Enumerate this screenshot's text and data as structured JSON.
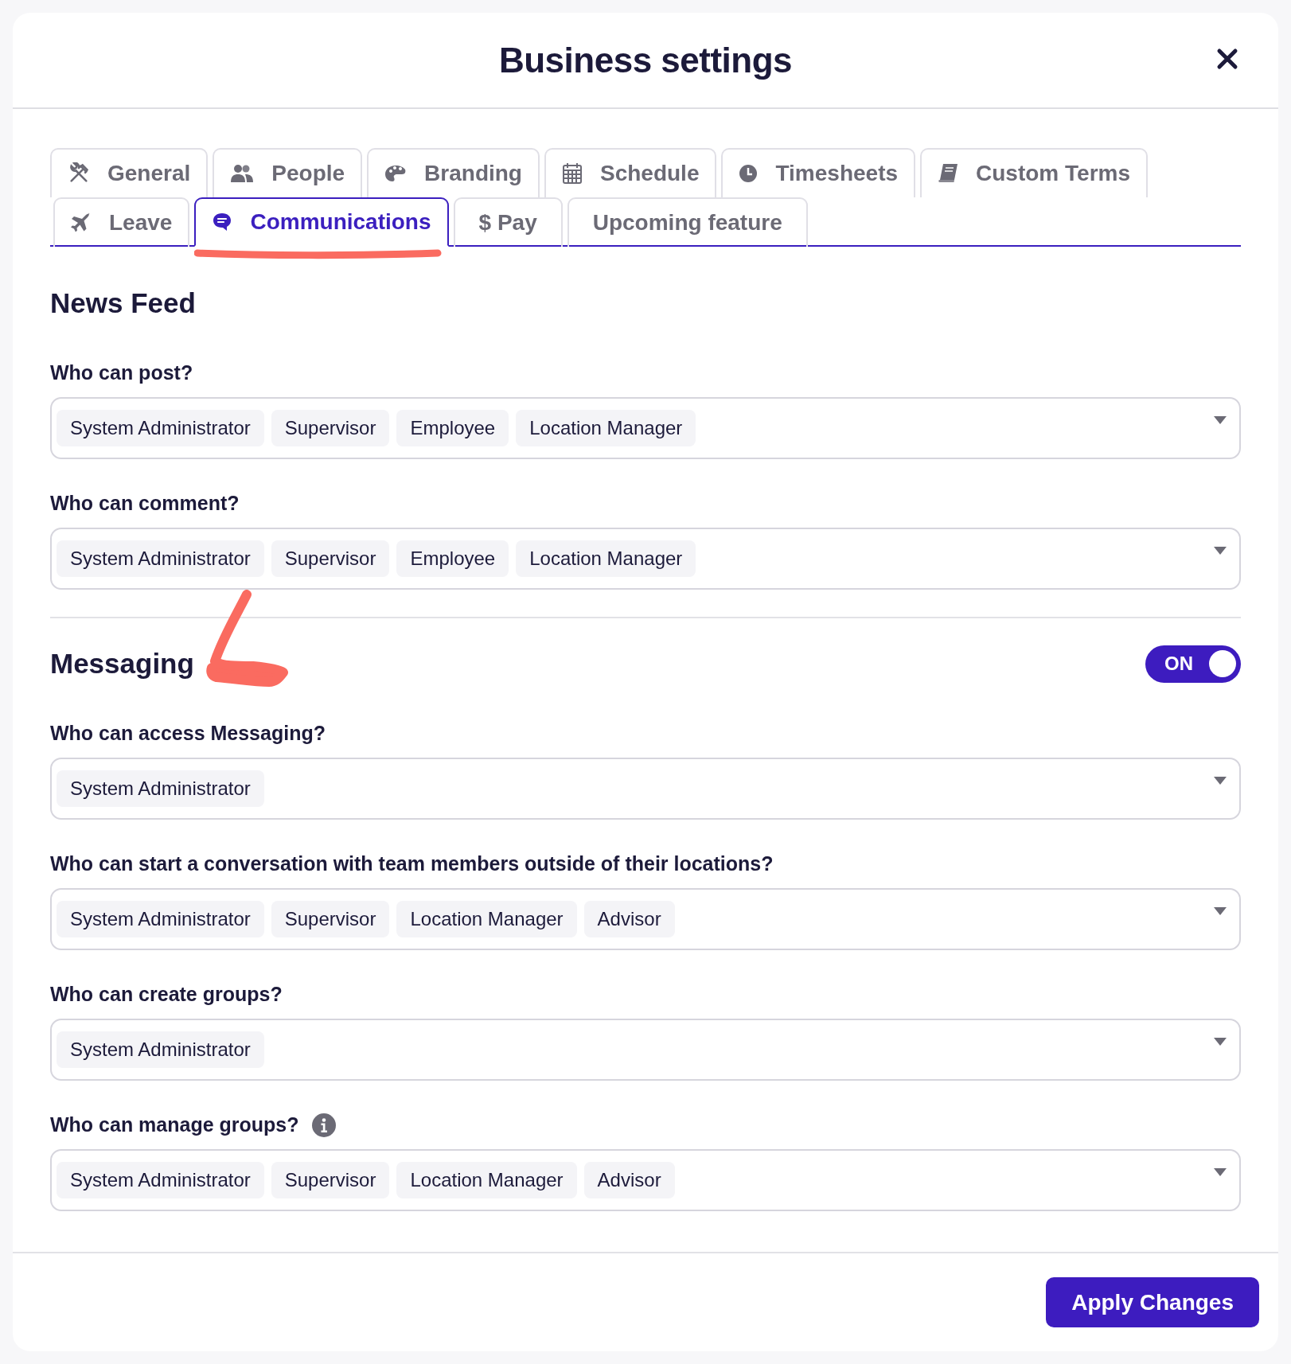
{
  "dialog": {
    "title": "Business settings"
  },
  "tab_rows": [
    {
      "tabs": [
        {
          "label": "General",
          "selected": false
        },
        {
          "label": "People",
          "selected": false
        },
        {
          "label": "Branding",
          "selected": false
        },
        {
          "label": "Schedule",
          "selected": false
        },
        {
          "label": "Timesheets",
          "selected": false
        },
        {
          "label": "Custom Terms",
          "selected": false
        }
      ]
    },
    {
      "tabs": [
        {
          "label": "Leave",
          "selected": false
        },
        {
          "label": "Communications",
          "selected": true
        },
        {
          "label": "$ Pay",
          "selected": false
        },
        {
          "label": "Upcoming feature",
          "selected": false
        }
      ]
    }
  ],
  "sections": [
    {
      "title": "News Feed",
      "fields": [
        {
          "label": "Who can post?",
          "chips": [
            "System Administrator",
            "Supervisor",
            "Employee",
            "Location Manager"
          ]
        },
        {
          "label": "Who can comment?",
          "chips": [
            "System Administrator",
            "Supervisor",
            "Employee",
            "Location Manager"
          ]
        }
      ]
    },
    {
      "title": "Messaging",
      "toggle": {
        "on": true,
        "label": "ON"
      },
      "fields": [
        {
          "label": "Who can access Messaging?",
          "chips": [
            "System Administrator"
          ]
        },
        {
          "label": "Who can start a conversation with team members outside of their locations?",
          "chips": [
            "System Administrator",
            "Supervisor",
            "Location Manager",
            "Advisor"
          ]
        },
        {
          "label": "Who can create groups?",
          "chips": [
            "System Administrator"
          ]
        },
        {
          "label": "Who can manage groups?",
          "info": true,
          "chips": [
            "System Administrator",
            "Supervisor",
            "Location Manager",
            "Advisor"
          ]
        }
      ]
    }
  ],
  "footer": {
    "button": "Apply Changes"
  }
}
